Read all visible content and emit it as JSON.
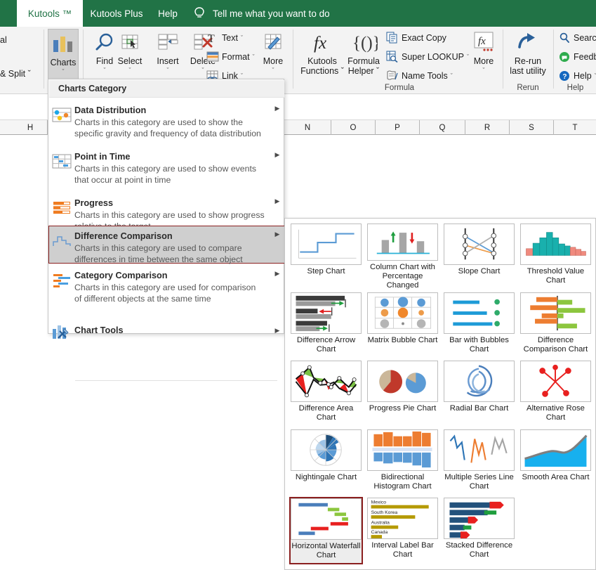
{
  "tabs": [
    {
      "label": "Kutools ™",
      "active": true
    },
    {
      "label": "Kutools Plus",
      "active": false
    },
    {
      "label": "Help",
      "active": false
    }
  ],
  "tellme": {
    "label": "Tell me what you want to do",
    "icon": "lightbulb-icon"
  },
  "ribbon": {
    "cut_labels": [
      "al",
      "& Split ˇ"
    ],
    "big_buttons": [
      {
        "label": "Charts",
        "caret": "ˇ",
        "icon": "bar-chart-icon",
        "selected": true
      },
      {
        "label": "Find",
        "caret": "ˇ",
        "icon": "magnifier-icon",
        "selected": false
      },
      {
        "label": "Select",
        "caret": "ˇ",
        "icon": "grid-select-icon",
        "selected": false
      },
      {
        "label": "Insert",
        "caret": "ˇ",
        "icon": "table-insert-icon",
        "selected": false
      },
      {
        "label": "Delete",
        "caret": "ˇ",
        "icon": "table-delete-icon",
        "selected": false
      },
      {
        "label": "More",
        "caret": "ˇ",
        "icon": "grid-pencil-icon",
        "selected": false
      },
      {
        "label": "More",
        "caret": "ˇ",
        "icon": "fx-more-icon",
        "selected": false
      }
    ],
    "small_buttons": [
      {
        "label": "Text",
        "caret": "ˇ",
        "icon": "text-t-icon"
      },
      {
        "label": "Format",
        "caret": "ˇ",
        "icon": "format-icon"
      },
      {
        "label": "Link",
        "caret": "ˇ",
        "icon": "link-icon"
      },
      {
        "label": "Exact Copy",
        "caret": "",
        "icon": "copy-icon"
      },
      {
        "label": "Super LOOKUP",
        "caret": "ˇ",
        "icon": "lookup-icon"
      },
      {
        "label": "Name Tools",
        "caret": "ˇ",
        "icon": "name-tools-icon"
      },
      {
        "label": "Search",
        "caret": "",
        "icon": "search-icon"
      },
      {
        "label": "Feedba",
        "caret": "",
        "icon": "feedback-icon"
      },
      {
        "label": "Help",
        "caret": "ˇ",
        "icon": "help-circle-icon"
      }
    ],
    "formula_buttons": [
      {
        "line1": "Kutools",
        "line2": "Functions ˇ",
        "icon": "fx-italic-icon"
      },
      {
        "line1": "Formula",
        "line2": "Helper ˇ",
        "icon": "braces-icon"
      }
    ],
    "rerun": {
      "line1": "Re-run",
      "line2": "last utility",
      "icon": "rerun-arrow-icon"
    },
    "group_labels": [
      "Formula",
      "Rerun",
      "Help"
    ]
  },
  "sheet": {
    "column_headers": [
      "H",
      "N",
      "O",
      "P",
      "Q",
      "R",
      "S",
      "T"
    ]
  },
  "charts_category": {
    "header": "Charts Category",
    "items": [
      {
        "title": "Data Distribution",
        "desc_line1": "Charts in this category are used to show the",
        "desc_line2": "specific gravity and frequency of data distribution",
        "icon": "data-distribution-icon",
        "arrow": "▶",
        "highlighted": false
      },
      {
        "title": "Point in Time",
        "desc_line1": "Charts in this category are used to show events",
        "desc_line2": "that occur at point in time",
        "icon": "point-in-time-icon",
        "arrow": "▶",
        "highlighted": false
      },
      {
        "title": "Progress",
        "desc_line1": "Charts in this category are used to show progress",
        "desc_line2": "relative to the target",
        "icon": "progress-icon",
        "arrow": "▶",
        "highlighted": false
      },
      {
        "title": "Difference Comparison",
        "desc_line1": "Charts in this category are used to compare",
        "desc_line2": "differences in time between the same object",
        "icon": "difference-comparison-icon",
        "arrow": "▶",
        "highlighted": true
      },
      {
        "title": "Category Comparison",
        "desc_line1": "Charts in this category are used for comparison",
        "desc_line2": "of different objects at the same time",
        "icon": "category-comparison-icon",
        "arrow": "▶",
        "highlighted": false
      },
      {
        "title": "Chart Tools",
        "desc_line1": "",
        "desc_line2": "",
        "icon": "chart-tools-icon",
        "arrow": "▶",
        "highlighted": false
      }
    ]
  },
  "gallery": {
    "items": [
      {
        "label": "Step Chart",
        "thumb": "step-chart-thumb",
        "selected": false
      },
      {
        "label": "Column Chart with Percentage Changed",
        "thumb": "column-percentage-thumb",
        "selected": false
      },
      {
        "label": "Slope Chart",
        "thumb": "slope-chart-thumb",
        "selected": false
      },
      {
        "label": "Threshold Value Chart",
        "thumb": "threshold-value-thumb",
        "selected": false
      },
      {
        "label": "Difference Arrow Chart",
        "thumb": "difference-arrow-thumb",
        "selected": false
      },
      {
        "label": "Matrix Bubble Chart",
        "thumb": "matrix-bubble-thumb",
        "selected": false
      },
      {
        "label": "Bar with Bubbles Chart",
        "thumb": "bar-bubbles-thumb",
        "selected": false
      },
      {
        "label": "Difference Comparison Chart",
        "thumb": "difference-comparison-thumb",
        "selected": false
      },
      {
        "label": "Difference Area Chart",
        "thumb": "difference-area-thumb",
        "selected": false
      },
      {
        "label": "Progress Pie Chart",
        "thumb": "progress-pie-thumb",
        "selected": false
      },
      {
        "label": "Radial Bar Chart",
        "thumb": "radial-bar-thumb",
        "selected": false
      },
      {
        "label": "Alternative Rose Chart",
        "thumb": "alternative-rose-thumb",
        "selected": false
      },
      {
        "label": "Nightingale Chart",
        "thumb": "nightingale-thumb",
        "selected": false
      },
      {
        "label": "Bidirectional Histogram Chart",
        "thumb": "bidirectional-histogram-thumb",
        "selected": false
      },
      {
        "label": "Multiple Series Line Chart",
        "thumb": "multiple-series-line-thumb",
        "selected": false
      },
      {
        "label": "Smooth Area Chart",
        "thumb": "smooth-area-thumb",
        "selected": false
      },
      {
        "label": "Horizontal Waterfall Chart",
        "thumb": "horizontal-waterfall-thumb",
        "selected": true
      },
      {
        "label": "Interval Label Bar Chart",
        "thumb": "interval-label-bar-thumb",
        "selected": false
      },
      {
        "label": "Stacked Difference Chart",
        "thumb": "stacked-difference-thumb",
        "selected": false
      }
    ],
    "interval_label_countries": [
      "Mexico",
      "South Korea",
      "Australia",
      "Canada"
    ]
  },
  "colors": {
    "excel_green": "#217346",
    "accent_blue": "#4a7ebb",
    "orange": "#ed7d31",
    "selection_red": "#8b2020",
    "teal": "#19b0ad",
    "salmon": "#f08a7e",
    "green": "#76bc21",
    "gold": "#b59a00",
    "navy": "#23527c"
  }
}
